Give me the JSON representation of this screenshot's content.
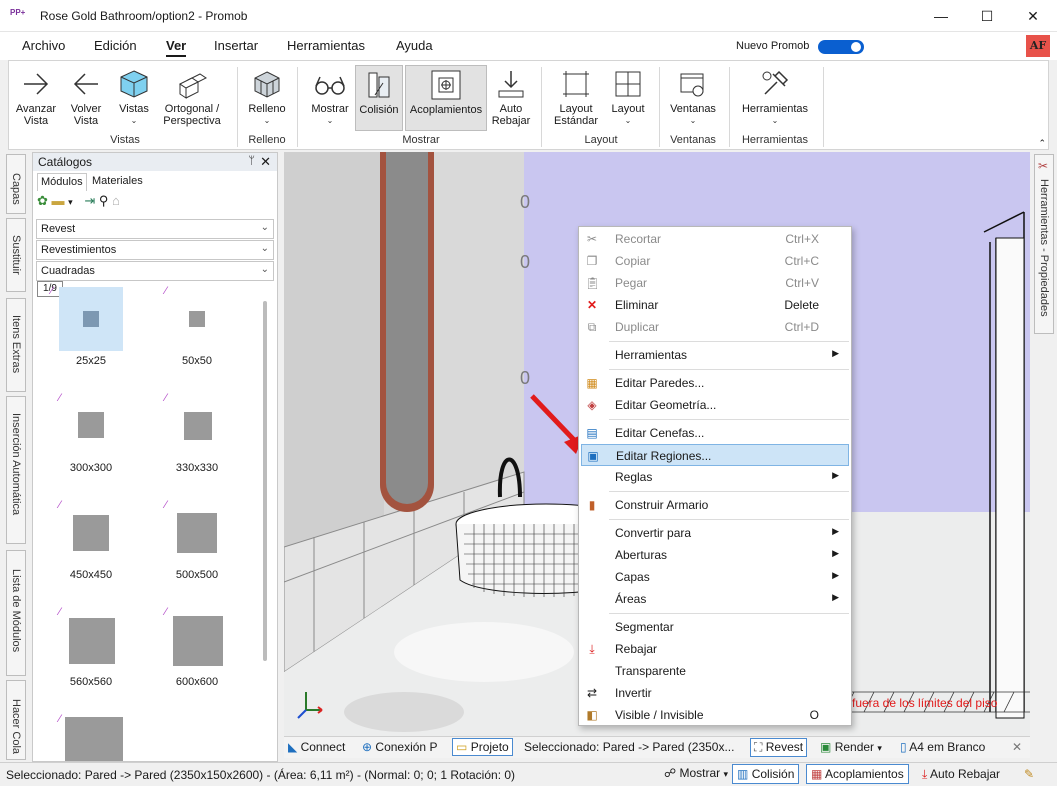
{
  "window": {
    "title": "Rose Gold Bathroom/option2 - Promob",
    "logo_text": "PP+",
    "minimize": "—",
    "maximize": "☐",
    "close": "✕"
  },
  "menu": {
    "items": [
      "Archivo",
      "Edición",
      "Ver",
      "Insertar",
      "Herramientas",
      "Ayuda"
    ],
    "active": "Ver",
    "nuevo_promob": "Nuevo Promob",
    "toggle_on": true,
    "avatar": "AF"
  },
  "ribbon": {
    "buttons": [
      {
        "id": "avanzar",
        "label": "Avanzar\nVista",
        "icon": "arrow-right-icon"
      },
      {
        "id": "volver",
        "label": "Volver\nVista",
        "icon": "arrow-left-icon"
      },
      {
        "id": "vistas",
        "label": "Vistas",
        "icon": "cube-icon"
      },
      {
        "id": "ortogonal",
        "label": "Ortogonal /\nPerspectiva",
        "icon": "ortho-cube-icon"
      },
      {
        "id": "relleno",
        "label": "Relleno",
        "icon": "fill-cube-icon"
      },
      {
        "id": "mostrar",
        "label": "Mostrar",
        "icon": "glasses-icon"
      },
      {
        "id": "colision",
        "label": "Colisión",
        "icon": "collision-icon",
        "selected": true
      },
      {
        "id": "acoplamientos",
        "label": "Acoplamientos",
        "icon": "coupling-icon",
        "selected": true
      },
      {
        "id": "auto_rebajar",
        "label": "Auto\nRebajar",
        "icon": "auto-lower-icon"
      },
      {
        "id": "layout_estandar",
        "label": "Layout\nEstándar",
        "icon": "layout-standard-icon"
      },
      {
        "id": "layout",
        "label": "Layout",
        "icon": "layout-grid-icon"
      },
      {
        "id": "ventanas",
        "label": "Ventanas",
        "icon": "window-gear-icon"
      },
      {
        "id": "herramientas",
        "label": "Herramientas",
        "icon": "tools-icon"
      }
    ],
    "groups": [
      "Vistas",
      "Relleno",
      "Mostrar",
      "Layout",
      "Ventanas",
      "Herramientas"
    ]
  },
  "left_tabs": [
    "Capas",
    "Sustituir",
    "Itens Extras",
    "Inserción Automática",
    "Lista de Módulos",
    "Hacer Cola"
  ],
  "catalog": {
    "title": "Catálogos",
    "pin": "ᛘ",
    "close": "✕",
    "tabs": [
      "Módulos",
      "Materiales"
    ],
    "active_tab": "Módulos",
    "dropdowns": [
      "Revest",
      "Revestimientos",
      "Cuadradas"
    ],
    "pager": "1/9",
    "tiles": [
      "25x25",
      "50x50",
      "300x300",
      "330x330",
      "450x450",
      "500x500",
      "560x560",
      "600x600",
      ""
    ],
    "selected_tile": "25x25"
  },
  "context_menu": {
    "items": [
      {
        "label": "Recortar",
        "shortcut": "Ctrl+X",
        "disabled": true,
        "icon": "scissors-icon"
      },
      {
        "label": "Copiar",
        "shortcut": "Ctrl+C",
        "disabled": true,
        "icon": "copy-icon"
      },
      {
        "label": "Pegar",
        "shortcut": "Ctrl+V",
        "disabled": true,
        "icon": "paste-icon"
      },
      {
        "label": "Eliminar",
        "shortcut": "Delete",
        "disabled": false,
        "icon": "delete-x-icon"
      },
      {
        "label": "Duplicar",
        "shortcut": "Ctrl+D",
        "disabled": true,
        "icon": "duplicate-icon"
      },
      {
        "sep": true
      },
      {
        "label": "Herramientas",
        "submenu": true
      },
      {
        "sep": true
      },
      {
        "label": "Editar Paredes...",
        "icon": "wall-icon"
      },
      {
        "label": "Editar Geometría...",
        "icon": "geometry-icon"
      },
      {
        "sep": true
      },
      {
        "label": "Editar Cenefas...",
        "icon": "cenefa-icon"
      },
      {
        "label": "Editar Regiones...",
        "icon": "regions-icon",
        "highlighted": true
      },
      {
        "label": "Reglas",
        "submenu": true
      },
      {
        "sep": true
      },
      {
        "label": "Construir Armario",
        "icon": "cabinet-icon"
      },
      {
        "sep": true
      },
      {
        "label": "Convertir para",
        "submenu": true
      },
      {
        "label": "Aberturas",
        "submenu": true
      },
      {
        "label": "Capas",
        "submenu": true
      },
      {
        "label": "Áreas",
        "submenu": true
      },
      {
        "sep": true
      },
      {
        "label": "Segmentar"
      },
      {
        "label": "Rebajar",
        "icon": "lower-icon"
      },
      {
        "label": "Transparente"
      },
      {
        "label": "Invertir",
        "icon": "invert-icon"
      },
      {
        "label": "Visible / Invisible",
        "shortcut": "O",
        "icon": "visibility-icon"
      }
    ]
  },
  "viewport": {
    "ruler_labels": [
      "0",
      "0",
      "0"
    ],
    "warning": "fuera de los límites del piso"
  },
  "viewbar": {
    "connect": "Connect",
    "conexion": "Conexión P",
    "projeto": "Projeto",
    "selected": "Seleccionado: Pared -> Pared (2350x...",
    "revest": "Revest",
    "render": "Render",
    "a4": "A4 em Branco",
    "close": "✕"
  },
  "right_tab": "Herramientas - Propiedades",
  "statusbar": {
    "text": "Seleccionado: Pared -> Pared (2350x150x2600) - (Área: 6,11 m²) - (Normal: 0; 0; 1 Rotación: 0)",
    "mostrar": "Mostrar",
    "colision": "Colisión",
    "acoplamientos": "Acoplamientos",
    "auto_rebajar": "Auto Rebajar"
  },
  "colors": {
    "accent": "#0a5fd0",
    "highlight": "#cde4f7",
    "wall_lavender": "#c9c6f0",
    "warning_red": "#e11b1b"
  }
}
